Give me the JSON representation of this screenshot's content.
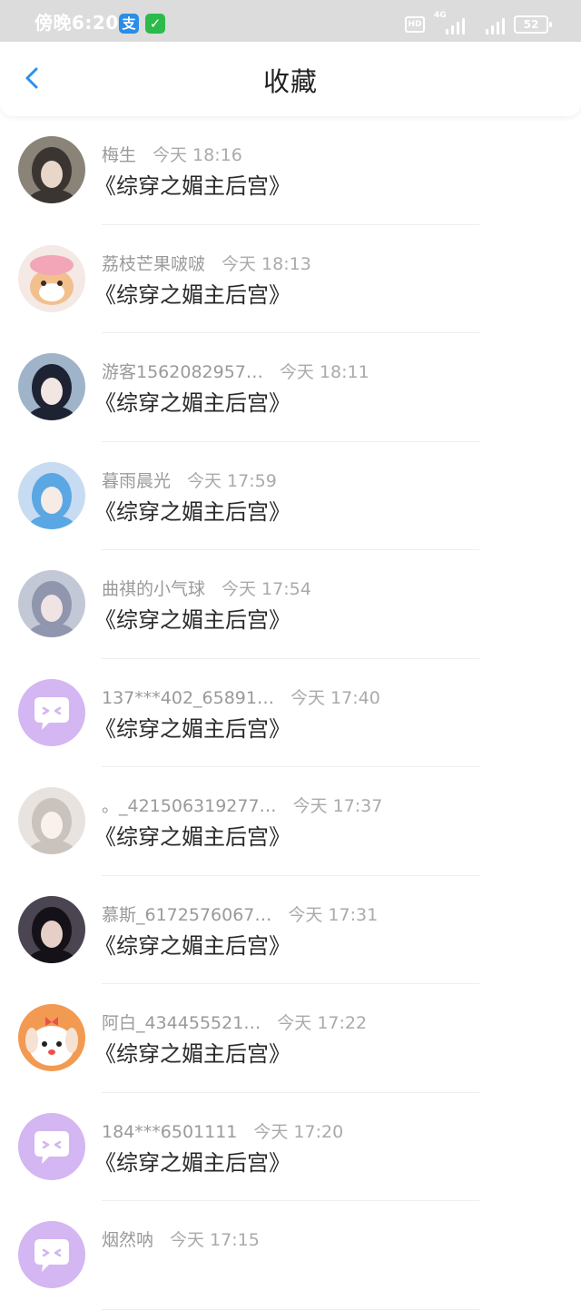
{
  "status_bar": {
    "time": "傍晚6:20",
    "alipay_glyph": "支",
    "wechat_glyph": "✓",
    "hd": "HD",
    "network": "4G",
    "battery": "52"
  },
  "header": {
    "title": "收藏",
    "back_icon": "chevron-left-icon"
  },
  "colors": {
    "accent": "#2b8ff0",
    "default_avatar": "#d3b6f2"
  },
  "favorites": [
    {
      "name": "梅生",
      "time": "今天 18:16",
      "title": "《综穿之媚主后宫》",
      "avatar": "photo"
    },
    {
      "name": "荔枝芒果啵啵",
      "time": "今天 18:13",
      "title": "《综穿之媚主后宫》",
      "avatar": "cat"
    },
    {
      "name": "游客1562082957…",
      "time": "今天 18:11",
      "title": "《综穿之媚主后宫》",
      "avatar": "anime-dark"
    },
    {
      "name": "暮雨晨光",
      "time": "今天 17:59",
      "title": "《综穿之媚主后宫》",
      "avatar": "anime-blue"
    },
    {
      "name": "曲祺的小气球",
      "time": "今天 17:54",
      "title": "《综穿之媚主后宫》",
      "avatar": "photo-blue"
    },
    {
      "name": "137***402_65891…",
      "time": "今天 17:40",
      "title": "《综穿之媚主后宫》",
      "avatar": "default"
    },
    {
      "name": "。_421506319277…",
      "time": "今天 17:37",
      "title": "《综穿之媚主后宫》",
      "avatar": "anime-light"
    },
    {
      "name": "慕斯_6172576067…",
      "time": "今天 17:31",
      "title": "《综穿之媚主后宫》",
      "avatar": "photo-dark"
    },
    {
      "name": "阿白_434455521…",
      "time": "今天 17:22",
      "title": "《综穿之媚主后宫》",
      "avatar": "dog"
    },
    {
      "name": "184***6501111",
      "time": "今天 17:20",
      "title": "《综穿之媚主后宫》",
      "avatar": "default"
    },
    {
      "name": "烟然呐",
      "time": "今天 17:15",
      "title": "",
      "avatar": "default"
    }
  ]
}
